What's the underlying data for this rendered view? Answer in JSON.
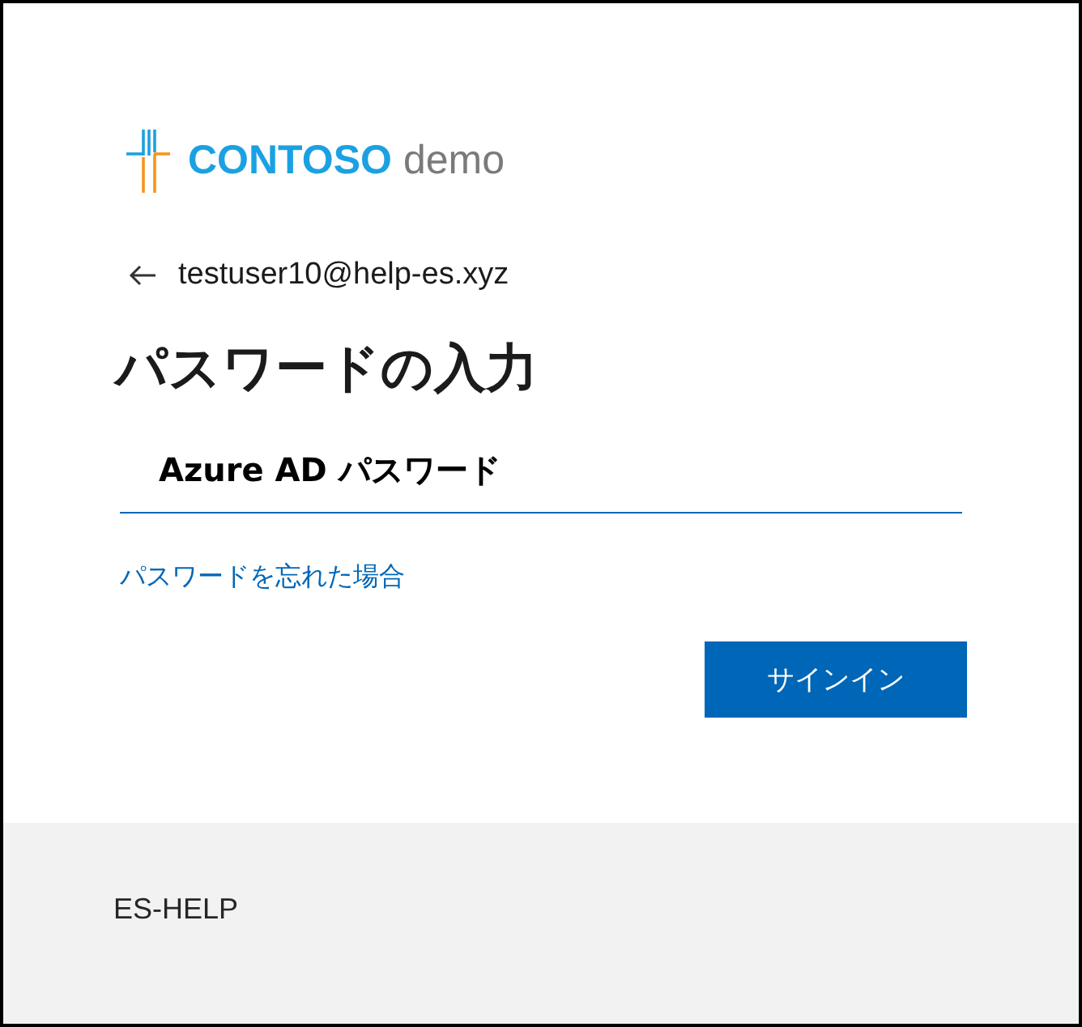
{
  "logo": {
    "brand": "CONTOSO",
    "suffix": "demo"
  },
  "identity": {
    "email": "testuser10@help-es.xyz"
  },
  "title": "パスワードの入力",
  "password_field": {
    "placeholder": "Azure AD パスワード"
  },
  "forgot_link": "パスワードを忘れた場合",
  "buttons": [
    {
      "label": "サインイン",
      "kind": "primary"
    }
  ],
  "footer": {
    "text": "ES-HELP"
  }
}
